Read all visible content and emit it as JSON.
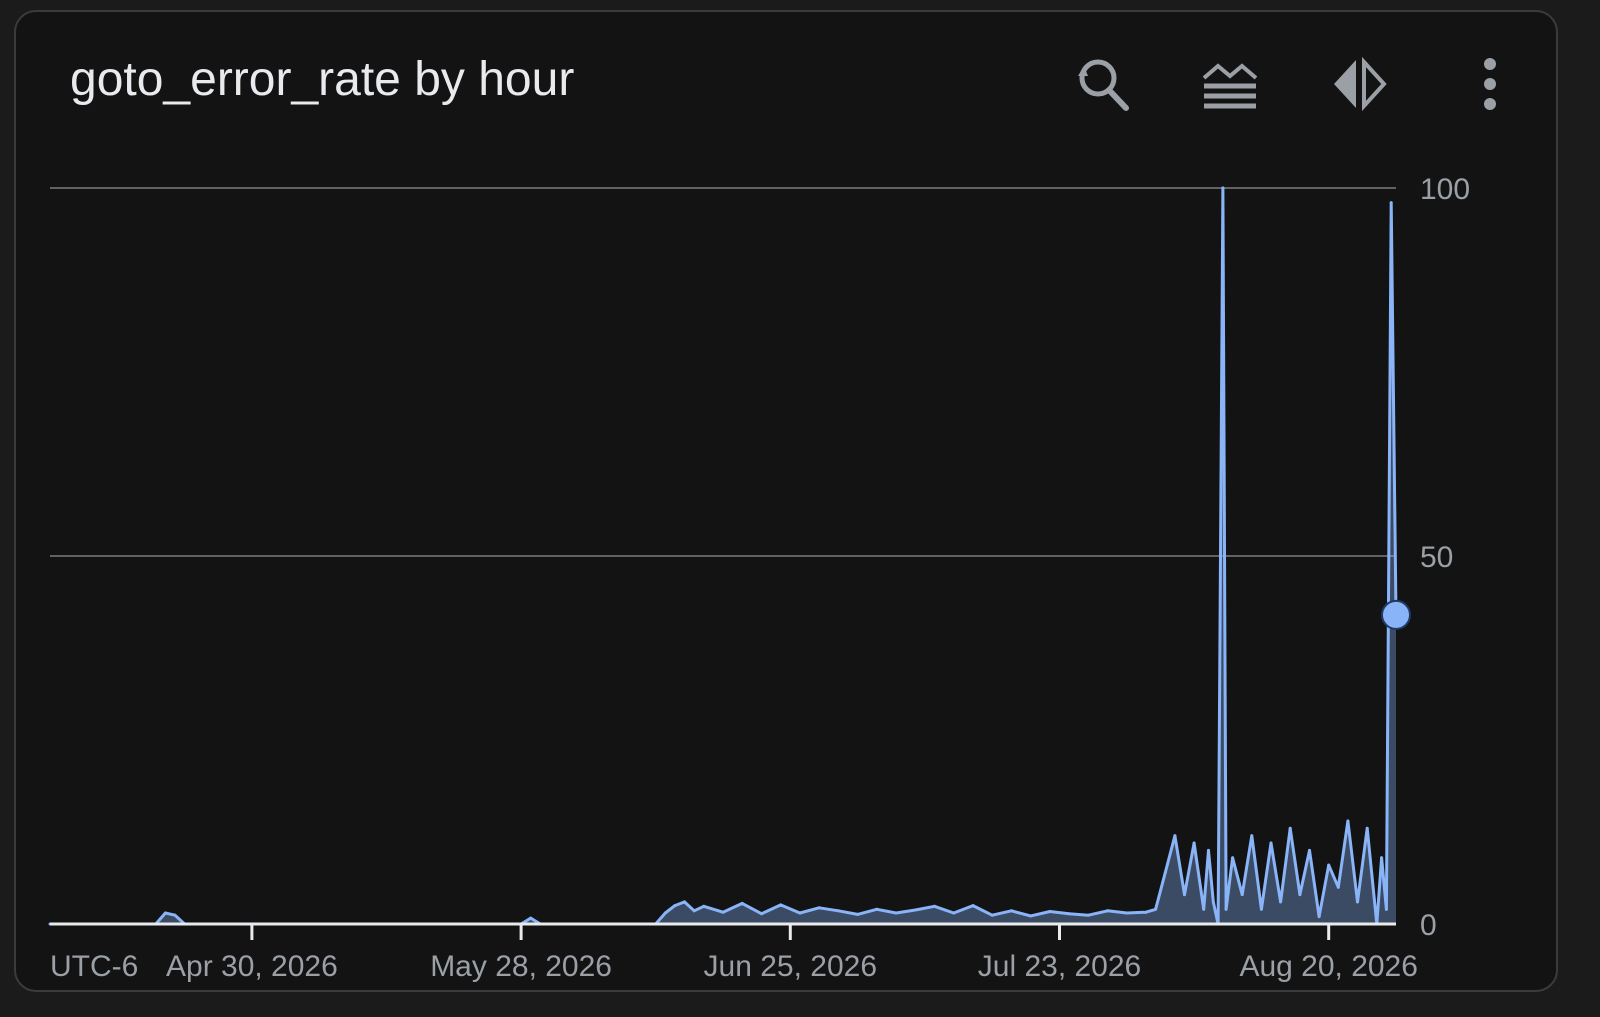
{
  "card": {
    "title": "goto_error_rate by hour"
  },
  "toolbar": {
    "icons": [
      "search-reset-icon",
      "stacked-layers-icon",
      "split-arrows-icon",
      "more-vert-icon"
    ]
  },
  "colors": {
    "background": "#131314",
    "series": "#8ab4f8",
    "grid": "#5f6368",
    "axis": "#e8eaed",
    "tick_text": "#9aa0a6"
  },
  "chart_data": {
    "type": "line",
    "title": "goto_error_rate by hour",
    "timezone_label": "UTC-6",
    "x_ticks": [
      "Apr 30, 2026",
      "May 28, 2026",
      "Jun 25, 2026",
      "Jul 23, 2026",
      "Aug 20, 2026"
    ],
    "x_range": [
      "2026-04-09",
      "2026-08-27"
    ],
    "ylim": [
      0,
      100
    ],
    "y_ticks": [
      0,
      50,
      100
    ],
    "grid": true,
    "y_axis_side": "right",
    "series": [
      {
        "points": [
          [
            "2026-04-09",
            0
          ],
          [
            "2026-04-20",
            0
          ],
          [
            "2026-04-21",
            1.5
          ],
          [
            "2026-04-22",
            1.2
          ],
          [
            "2026-04-23",
            0
          ],
          [
            "2026-05-28",
            0
          ],
          [
            "2026-05-29",
            0.8
          ],
          [
            "2026-05-30",
            0
          ],
          [
            "2026-06-11",
            0
          ],
          [
            "2026-06-12",
            1.5
          ],
          [
            "2026-06-13",
            2.5
          ],
          [
            "2026-06-14",
            3
          ],
          [
            "2026-06-15",
            1.8
          ],
          [
            "2026-06-16",
            2.4
          ],
          [
            "2026-06-18",
            1.6
          ],
          [
            "2026-06-20",
            2.8
          ],
          [
            "2026-06-22",
            1.4
          ],
          [
            "2026-06-24",
            2.6
          ],
          [
            "2026-06-26",
            1.5
          ],
          [
            "2026-06-28",
            2.2
          ],
          [
            "2026-06-30",
            1.8
          ],
          [
            "2026-07-02",
            1.3
          ],
          [
            "2026-07-04",
            2.0
          ],
          [
            "2026-07-06",
            1.5
          ],
          [
            "2026-07-08",
            1.9
          ],
          [
            "2026-07-10",
            2.4
          ],
          [
            "2026-07-12",
            1.5
          ],
          [
            "2026-07-14",
            2.5
          ],
          [
            "2026-07-16",
            1.2
          ],
          [
            "2026-07-18",
            1.8
          ],
          [
            "2026-07-20",
            1.1
          ],
          [
            "2026-07-22",
            1.7
          ],
          [
            "2026-07-24",
            1.4
          ],
          [
            "2026-07-26",
            1.2
          ],
          [
            "2026-07-28",
            1.8
          ],
          [
            "2026-07-30",
            1.5
          ],
          [
            "2026-08-01",
            1.6
          ],
          [
            "2026-08-02",
            2.0
          ],
          [
            "2026-08-03",
            7
          ],
          [
            "2026-08-04",
            12
          ],
          [
            "2026-08-05",
            4
          ],
          [
            "2026-08-06",
            11
          ],
          [
            "2026-08-07",
            2
          ],
          [
            "2026-08-07T12:00",
            10
          ],
          [
            "2026-08-08",
            3
          ],
          [
            "2026-08-08T12:00",
            0
          ],
          [
            "2026-08-09",
            100
          ],
          [
            "2026-08-09T08:00",
            2
          ],
          [
            "2026-08-10",
            9
          ],
          [
            "2026-08-11",
            4
          ],
          [
            "2026-08-12",
            12
          ],
          [
            "2026-08-13",
            2
          ],
          [
            "2026-08-14",
            11
          ],
          [
            "2026-08-15",
            3
          ],
          [
            "2026-08-16",
            13
          ],
          [
            "2026-08-17",
            4
          ],
          [
            "2026-08-18",
            10
          ],
          [
            "2026-08-19",
            1
          ],
          [
            "2026-08-20",
            8
          ],
          [
            "2026-08-21",
            5
          ],
          [
            "2026-08-22",
            14
          ],
          [
            "2026-08-23",
            3
          ],
          [
            "2026-08-24",
            13
          ],
          [
            "2026-08-25",
            0
          ],
          [
            "2026-08-25T12:00",
            9
          ],
          [
            "2026-08-26",
            2
          ],
          [
            "2026-08-26T12:00",
            98
          ],
          [
            "2026-08-27",
            42
          ]
        ]
      }
    ],
    "current_value_marker": 42
  }
}
